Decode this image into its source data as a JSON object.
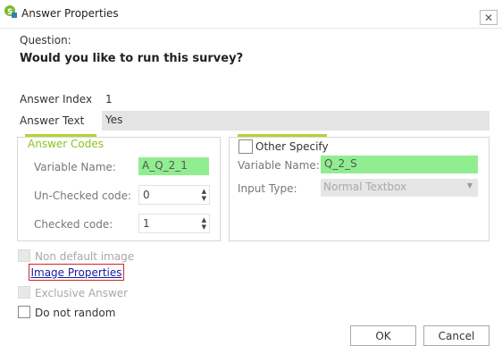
{
  "window": {
    "title": "Answer Properties",
    "close_glyph": "✕"
  },
  "question": {
    "label": "Question:",
    "text": "Would you like to run this survey?"
  },
  "answer": {
    "index_label": "Answer Index",
    "index_value": "1",
    "text_label": "Answer Text",
    "text_value": "Yes"
  },
  "answer_codes": {
    "legend": "Answer Codes",
    "variable_name_label": "Variable Name:",
    "variable_name_value": "A_Q_2_1",
    "unchecked_label": "Un-Checked code:",
    "unchecked_value": "0",
    "checked_label": "Checked code:",
    "checked_value": "1"
  },
  "other_specify": {
    "label": "Other Specify",
    "checked": false,
    "variable_name_label": "Variable Name:",
    "variable_name_value": "Q_2_S",
    "input_type_label": "Input Type:",
    "input_type_value": "Normal Textbox"
  },
  "options": {
    "non_default_image": "Non default image",
    "image_properties": "Image Properties",
    "exclusive_answer": "Exclusive Answer",
    "do_not_random": "Do not random"
  },
  "buttons": {
    "ok": "OK",
    "cancel": "Cancel"
  },
  "colors": {
    "accent_green": "#8dc21f",
    "field_green": "#90ee90",
    "link": "#1a1aa6",
    "highlight_border": "#d42525"
  },
  "icons": {
    "app": "survey-app-icon",
    "close": "close-icon",
    "spin": "spinner-arrows-icon",
    "dropdown": "dropdown-arrow-icon"
  }
}
